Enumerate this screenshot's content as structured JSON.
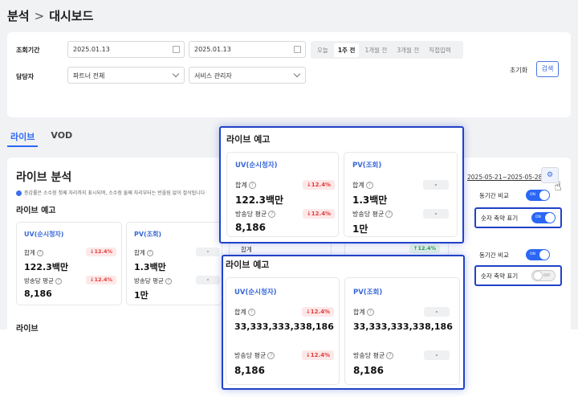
{
  "breadcrumb": {
    "section": "분석",
    "sep": ">",
    "page": "대시보드"
  },
  "filter": {
    "period_label": "조회기간",
    "start_date": "2025.01.13",
    "end_date": "2025.01.13",
    "ranges": [
      "오늘",
      "1주 전",
      "1개월 전",
      "3개월 전",
      "직접입력"
    ],
    "selected_range": "1주 전",
    "manager_label": "담당자",
    "partner_select": "파트너 전체",
    "service_select": "서비스 관리자",
    "reset_label": "초기화",
    "search_label": "검색"
  },
  "tabs": [
    {
      "label": "라이브"
    },
    {
      "label": "VOD"
    }
  ],
  "analysis": {
    "title": "라이브 분석",
    "note": "증감률은 소수점 첫째 자리까지 표시되며, 소수점 둘째 자리부터는 반올림 없이 절삭됩니다",
    "date_range": "2025-05-21~2025-05-28",
    "section_live_preview": "라이브 예고",
    "section_live": "라이브"
  },
  "cards": {
    "uv_title": "UV(순시청자)",
    "pv_title": "PV(조회)",
    "sum_label": "합계",
    "avg_label": "방송당 평균",
    "help_icon": "?",
    "uv_sum": "122.3백만",
    "uv_avg": "8,186",
    "pv_sum": "1.3백만",
    "pv_avg": "1만",
    "uv_sum_delta": "↓12.4%",
    "uv_avg_delta": "↓12.4%",
    "pv_delta": "-",
    "pv_up_delta": "↑12.4%"
  },
  "toggles": {
    "compare_label": "동기간 비교",
    "abbrev_label": "숫자 축약 표기",
    "on_text": "ON",
    "off_text": "OFF"
  },
  "callout_top": {
    "title": "라이브 예고",
    "uv_sum": "122.3백만",
    "uv_avg": "8,186",
    "pv_sum": "1.3백만",
    "pv_avg": "1만"
  },
  "callout_bottom": {
    "title": "라이브 예고",
    "uv_sum": "33,333,333,338,186",
    "uv_avg": "8,186",
    "pv_sum": "33,333,333,338,186",
    "pv_avg": "8,186"
  },
  "colors": {
    "accent": "#2b67f6",
    "highlight": "#2142c7",
    "down": "#e23c3c",
    "up": "#2f9c4d"
  }
}
